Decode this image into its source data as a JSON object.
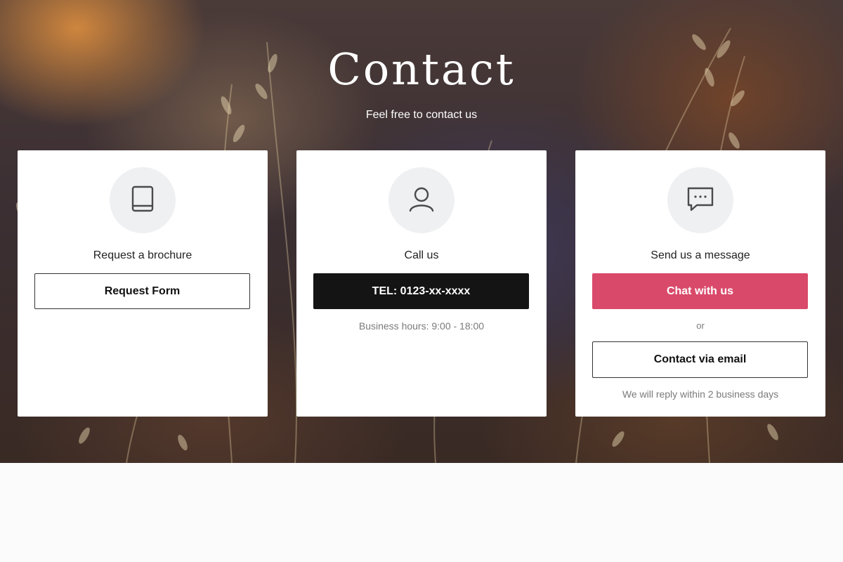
{
  "hero": {
    "title": "Contact",
    "subtitle": "Feel free to contact us"
  },
  "cards": [
    {
      "icon": "book-icon",
      "title": "Request a brochure",
      "button_label": "Request Form"
    },
    {
      "icon": "user-icon",
      "title": "Call us",
      "button_label": "TEL: 0123-xx-xxxx",
      "note": "Business hours: 9:00 - 18:00"
    },
    {
      "icon": "chat-bubble-icon",
      "title": "Send us a message",
      "button_label": "Chat with us",
      "separator": "or",
      "secondary_button_label": "Contact via email",
      "note": "We will reply within 2 business days"
    }
  ],
  "colors": {
    "chat_button": "#d9496a",
    "call_button": "#141414",
    "icon_circle": "#eff0f2",
    "page_background": "#fbfbfb"
  }
}
